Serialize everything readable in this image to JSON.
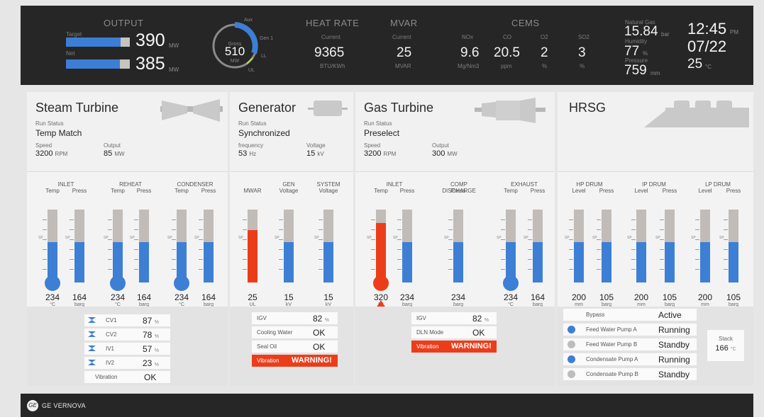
{
  "top": {
    "output_label": "OUTPUT",
    "target_label": "Target",
    "net_label": "Net",
    "target_value": "390",
    "net_value": "385",
    "mw_unit": "MW",
    "target_fraction": 0.86,
    "net_fraction": 0.84,
    "dial_value": "510",
    "dial_gross": "Gross",
    "dial_unit": "MW",
    "dial_aux": "Aux",
    "dial_gen": "Gen 1",
    "dial_ll": "LL",
    "dial_ul": "UL",
    "heat_label": "HEAT RATE",
    "heat_current_label": "Current",
    "heat_value": "9365",
    "heat_unit": "BTU/KWh",
    "mvar_label": "MVAR",
    "mvar_current_label": "Current",
    "mvar_value": "25",
    "mvar_unit": "MVAR",
    "cems_label": "CEMS",
    "cems": [
      {
        "name": "NOx",
        "value": "9.6",
        "unit": "Mg/Nm3"
      },
      {
        "name": "CO",
        "value": "20.5",
        "unit": "ppm"
      },
      {
        "name": "O2",
        "value": "2",
        "unit": "%"
      },
      {
        "name": "SO2",
        "value": "3",
        "unit": "%"
      }
    ],
    "gas_label": "Natural Gas",
    "gas_value": "15.84",
    "gas_unit": "bar",
    "hum_label": "Humidity",
    "hum_value": "77",
    "hum_unit": "%",
    "press_label": "Pressure",
    "press_value": "759",
    "press_unit": "mm",
    "time": "12:45",
    "ampm": "PM",
    "date": "07/22",
    "temp": "25",
    "temp_unit": "°C"
  },
  "steam": {
    "title": "Steam Turbine",
    "run_status_label": "Run Status",
    "run_status": "Temp Match",
    "speed_label": "Speed",
    "speed": "3200",
    "speed_unit": "RPM",
    "output_label": "Output",
    "output": "85",
    "output_unit": "MW",
    "groups": [
      "INLET",
      "REHEAT",
      "CONDENSER"
    ],
    "temp_label": "Temp",
    "press_label": "Press",
    "gauges": [
      {
        "value": "234",
        "unit": "°C",
        "fill": 0.55
      },
      {
        "value": "164",
        "unit": "barg",
        "fill": 0.55
      },
      {
        "value": "234",
        "unit": "°C",
        "fill": 0.55
      },
      {
        "value": "164",
        "unit": "barg",
        "fill": 0.55
      },
      {
        "value": "234",
        "unit": "°C",
        "fill": 0.55
      },
      {
        "value": "164",
        "unit": "barg",
        "fill": 0.55
      }
    ],
    "rows": [
      {
        "key": "CV1",
        "value": "87",
        "unit": "%"
      },
      {
        "key": "CV2",
        "value": "78",
        "unit": "%"
      },
      {
        "key": "IV1",
        "value": "57",
        "unit": "%"
      },
      {
        "key": "IV2",
        "value": "23",
        "unit": "%"
      }
    ],
    "vibration_label": "Vibration",
    "vibration_value": "OK"
  },
  "gen": {
    "title": "Generator",
    "run_status_label": "Run Status",
    "run_status": "Synchronized",
    "freq_label": "frequency",
    "freq": "53",
    "freq_unit": "Hz",
    "volt_label": "Voltage",
    "volt": "15",
    "volt_unit": "kV",
    "h_mwar": "MWAR",
    "h_gen": "GEN",
    "h_gen2": "Voltage",
    "h_sys": "SYSTEM",
    "h_sys2": "Voltage",
    "gauges": [
      {
        "value": "25",
        "unit": "UL",
        "fill": 0.72
      },
      {
        "value": "15",
        "unit": "kV",
        "fill": 0.55
      },
      {
        "value": "15",
        "unit": "kV",
        "fill": 0.55
      }
    ],
    "rows": [
      {
        "key": "IGV",
        "value": "82",
        "unit": "%"
      },
      {
        "key": "Cooling Water",
        "value": "OK",
        "unit": ""
      },
      {
        "key": "Seal Oil",
        "value": "OK",
        "unit": ""
      },
      {
        "key": "Vibration",
        "value": "WARNING!",
        "unit": ""
      }
    ]
  },
  "gas": {
    "title": "Gas Turbine",
    "run_status_label": "Run Status",
    "run_status": "Preselect",
    "speed_label": "Speed",
    "speed": "3200",
    "speed_unit": "RPM",
    "output_label": "Output",
    "output": "300",
    "output_unit": "MW",
    "h_inlet": "INLET",
    "h_comp": "COMP DISCHARGE",
    "h_exh": "EXHAUST",
    "temp_label": "Temp",
    "press_label": "Press",
    "gauges": [
      {
        "value": "320",
        "unit": "°C",
        "fill": 0.82
      },
      {
        "value": "234",
        "unit": "barg",
        "fill": 0.55
      },
      {
        "value": "234",
        "unit": "barg",
        "fill": 0.55
      },
      {
        "value": "234",
        "unit": "°C",
        "fill": 0.55
      },
      {
        "value": "164",
        "unit": "barg",
        "fill": 0.55
      }
    ],
    "rows": [
      {
        "key": "IGV",
        "value": "82",
        "unit": "%"
      },
      {
        "key": "DLN Mode",
        "value": "OK",
        "unit": ""
      },
      {
        "key": "Vibration",
        "value": "WARNING!",
        "unit": ""
      }
    ]
  },
  "hrsg": {
    "title": "HRSG",
    "groups": [
      "HP DRUM",
      "IP DRUM",
      "LP DRUM"
    ],
    "level_label": "Level",
    "press_label": "Press",
    "gauges": [
      {
        "value": "200",
        "unit": "mm",
        "fill": 0.55
      },
      {
        "value": "105",
        "unit": "barg",
        "fill": 0.55
      },
      {
        "value": "200",
        "unit": "mm",
        "fill": 0.55
      },
      {
        "value": "105",
        "unit": "barg",
        "fill": 0.55
      },
      {
        "value": "200",
        "unit": "mm",
        "fill": 0.55
      },
      {
        "value": "105",
        "unit": "barg",
        "fill": 0.55
      }
    ],
    "rows": [
      {
        "key": "Bypass",
        "value": "Active"
      },
      {
        "key": "Feed Water Pump A",
        "value": "Running"
      },
      {
        "key": "Feed Water Pump B",
        "value": "Standby"
      },
      {
        "key": "Condensate Pump A",
        "value": "Running"
      },
      {
        "key": "Condensate Pump B",
        "value": "Standby"
      }
    ],
    "stack_label": "Stack",
    "stack_value": "166",
    "stack_unit": "°C"
  },
  "sp_label": "SP",
  "brand": "GE VERNOVA",
  "colors": {
    "blue": "#3d7fd4",
    "red": "#ec3d1a",
    "dark": "#262626"
  }
}
